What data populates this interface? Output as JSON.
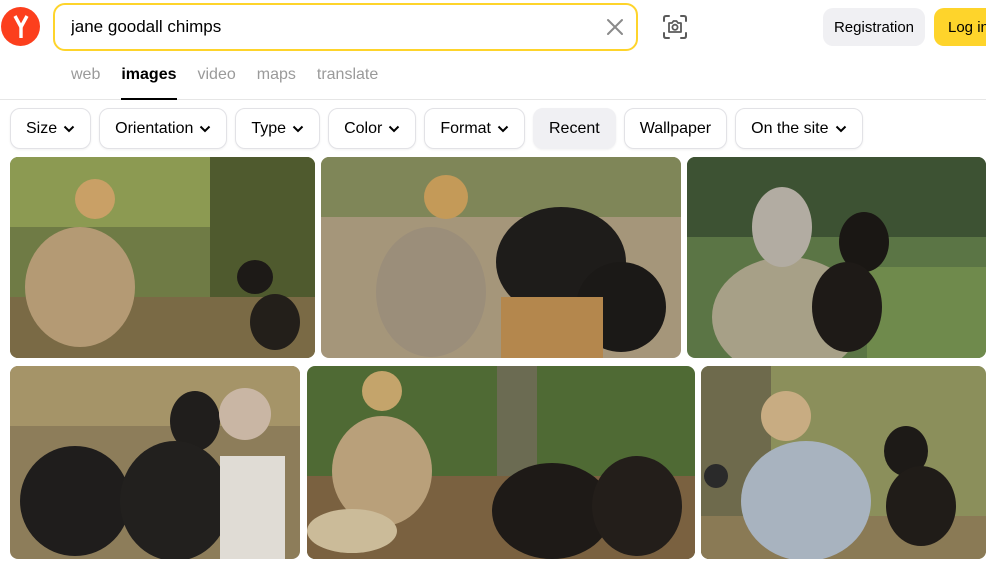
{
  "search": {
    "query": "jane goodall chimps"
  },
  "header": {
    "registration_label": "Registration",
    "login_label": "Log in"
  },
  "tabs": [
    {
      "label": "web"
    },
    {
      "label": "images"
    },
    {
      "label": "video"
    },
    {
      "label": "maps"
    },
    {
      "label": "translate"
    }
  ],
  "filters": [
    {
      "label": "Size",
      "dropdown": true
    },
    {
      "label": "Orientation",
      "dropdown": true
    },
    {
      "label": "Type",
      "dropdown": true
    },
    {
      "label": "Color",
      "dropdown": true
    },
    {
      "label": "Format",
      "dropdown": true
    },
    {
      "label": "Recent",
      "dropdown": false
    },
    {
      "label": "Wallpaper",
      "dropdown": false
    },
    {
      "label": "On the site",
      "dropdown": true
    }
  ],
  "icons": {
    "logo": "yandex-logo-icon",
    "clear": "close-icon",
    "camera": "camera-search-icon",
    "chevron": "chevron-down-icon"
  },
  "colors": {
    "accent": "#fed42b",
    "logo": "#fc3f1d",
    "chip_gray": "#f0f0f3"
  }
}
